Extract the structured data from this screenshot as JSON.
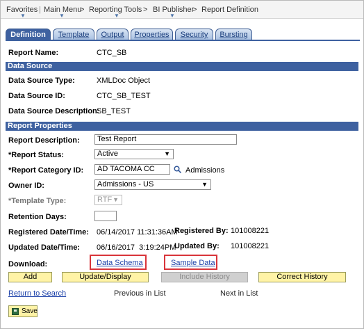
{
  "breadcrumb": {
    "items": [
      "Favorites",
      "Main Menu",
      "Reporting Tools",
      "BI Publisher",
      "Report Definition"
    ]
  },
  "tabs": [
    "Definition",
    "Template",
    "Output",
    "Properties",
    "Security",
    "Bursting"
  ],
  "report_name": {
    "label": "Report Name:",
    "value": "CTC_SB"
  },
  "data_source": {
    "title": "Data Source",
    "type_label": "Data Source Type:",
    "type_value": "XMLDoc Object",
    "id_label": "Data Source ID:",
    "id_value": "CTC_SB_TEST",
    "desc_label": "Data Source Description:",
    "desc_value": "SB_TEST"
  },
  "report_properties": {
    "title": "Report Properties",
    "description_label": "Report Description:",
    "description_value": "Test Report",
    "status_label": "*Report Status:",
    "status_value": "Active",
    "category_label": "*Report Category ID:",
    "category_value": "AD TACOMA CC",
    "category_desc": "Admissions",
    "owner_label": "Owner ID:",
    "owner_value": "Admissions - US",
    "template_type_label": "*Template Type:",
    "template_type_value": "RTF",
    "retention_label": "Retention Days:",
    "retention_value": "",
    "registered_dt_label": "Registered Date/Time:",
    "registered_dt_value": "06/14/2017 11:31:36AM",
    "registered_by_label": "Registered By:",
    "registered_by_value": "101008221",
    "updated_dt_label": "Updated Date/Time:",
    "updated_dt_value": "06/16/2017  3:19:24PM",
    "updated_by_label": "Updated By:",
    "updated_by_value": "101008221"
  },
  "download": {
    "label": "Download:",
    "schema_link": "Data Schema",
    "sample_link": "Sample Data"
  },
  "buttons": {
    "add": "Add",
    "update_display": "Update/Display",
    "include_history": "Include History",
    "correct_history": "Correct History",
    "save": "Save"
  },
  "navigation": {
    "return_to_search": "Return to Search",
    "previous_in_list": "Previous in List",
    "next_in_list": "Next in List"
  },
  "colors": {
    "header_band": "#3e61a0",
    "button_yellow": "#fff3a6",
    "highlight_red": "#d9343a",
    "link_blue": "#1a3fa8"
  },
  "icons": {
    "lookup": "magnifier-icon",
    "dropdown": "chevron-down-icon",
    "save": "floppy-disk-icon"
  }
}
